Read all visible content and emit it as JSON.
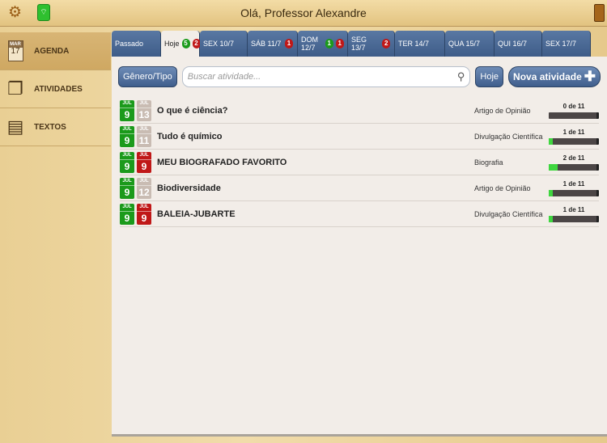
{
  "header": {
    "title": "Olá, Professor Alexandre",
    "icons": [
      "gear-icon",
      "wifi-icon",
      "book-icon"
    ]
  },
  "sidebar": {
    "items": [
      {
        "label": "AGENDA",
        "cal_month": "MAR",
        "cal_day": "17"
      },
      {
        "label": "ATIVIDADES"
      },
      {
        "label": "TEXTOS"
      }
    ]
  },
  "tabs": [
    {
      "label": "Passado",
      "badges": []
    },
    {
      "label": "Hoje",
      "badges": [
        {
          "n": "5",
          "c": "g"
        },
        {
          "n": "2",
          "c": "r"
        }
      ],
      "active": true
    },
    {
      "label": "SEX 10/7",
      "badges": []
    },
    {
      "label": "SÁB 11/7",
      "badges": [
        {
          "n": "1",
          "c": "r"
        }
      ]
    },
    {
      "label": "DOM 12/7",
      "badges": [
        {
          "n": "1",
          "c": "g"
        },
        {
          "n": "1",
          "c": "r"
        }
      ]
    },
    {
      "label": "SEG 13/7",
      "badges": [
        {
          "n": "2",
          "c": "r"
        }
      ]
    },
    {
      "label": "TER 14/7",
      "badges": []
    },
    {
      "label": "QUA 15/7",
      "badges": []
    },
    {
      "label": "QUI 16/7",
      "badges": []
    },
    {
      "label": "SEX 17/7",
      "badges": []
    }
  ],
  "toolbar": {
    "genre_button": "Gênero/Tipo",
    "search_placeholder": "Buscar atividade...",
    "today_button": "Hoje",
    "new_button": "Nova atividade"
  },
  "activities": [
    {
      "start": {
        "month": "JUL",
        "day": "9",
        "status": "green"
      },
      "end": {
        "month": "JUL",
        "day": "13",
        "status": "neutral"
      },
      "title": "O que é ciência?",
      "genre": "Artigo de Opinião",
      "progress": "0 de 11",
      "done": 0,
      "total": 11
    },
    {
      "start": {
        "month": "JUL",
        "day": "9",
        "status": "green"
      },
      "end": {
        "month": "JUL",
        "day": "11",
        "status": "neutral"
      },
      "title": "Tudo é químico",
      "genre": "Divulgação Científica",
      "progress": "1 de 11",
      "done": 1,
      "total": 11
    },
    {
      "start": {
        "month": "JUL",
        "day": "9",
        "status": "green"
      },
      "end": {
        "month": "JUL",
        "day": "9",
        "status": "red"
      },
      "title": "MEU BIOGRAFADO FAVORITO",
      "genre": "Biografia",
      "progress": "2 de 11",
      "done": 2,
      "total": 11
    },
    {
      "start": {
        "month": "JUL",
        "day": "9",
        "status": "green"
      },
      "end": {
        "month": "JUL",
        "day": "12",
        "status": "neutral"
      },
      "title": "Biodiversidade",
      "genre": "Artigo de Opinião",
      "progress": "1 de 11",
      "done": 1,
      "total": 11
    },
    {
      "start": {
        "month": "JUL",
        "day": "9",
        "status": "green"
      },
      "end": {
        "month": "JUL",
        "day": "9",
        "status": "red"
      },
      "title": "BALEIA-JUBARTE",
      "genre": "Divulgação Científica",
      "progress": "1 de 11",
      "done": 1,
      "total": 11
    }
  ],
  "colors": {
    "tab": "#4a6a96",
    "green": "#1b9a1b",
    "red": "#c01818",
    "progress": "#3fd63f"
  }
}
